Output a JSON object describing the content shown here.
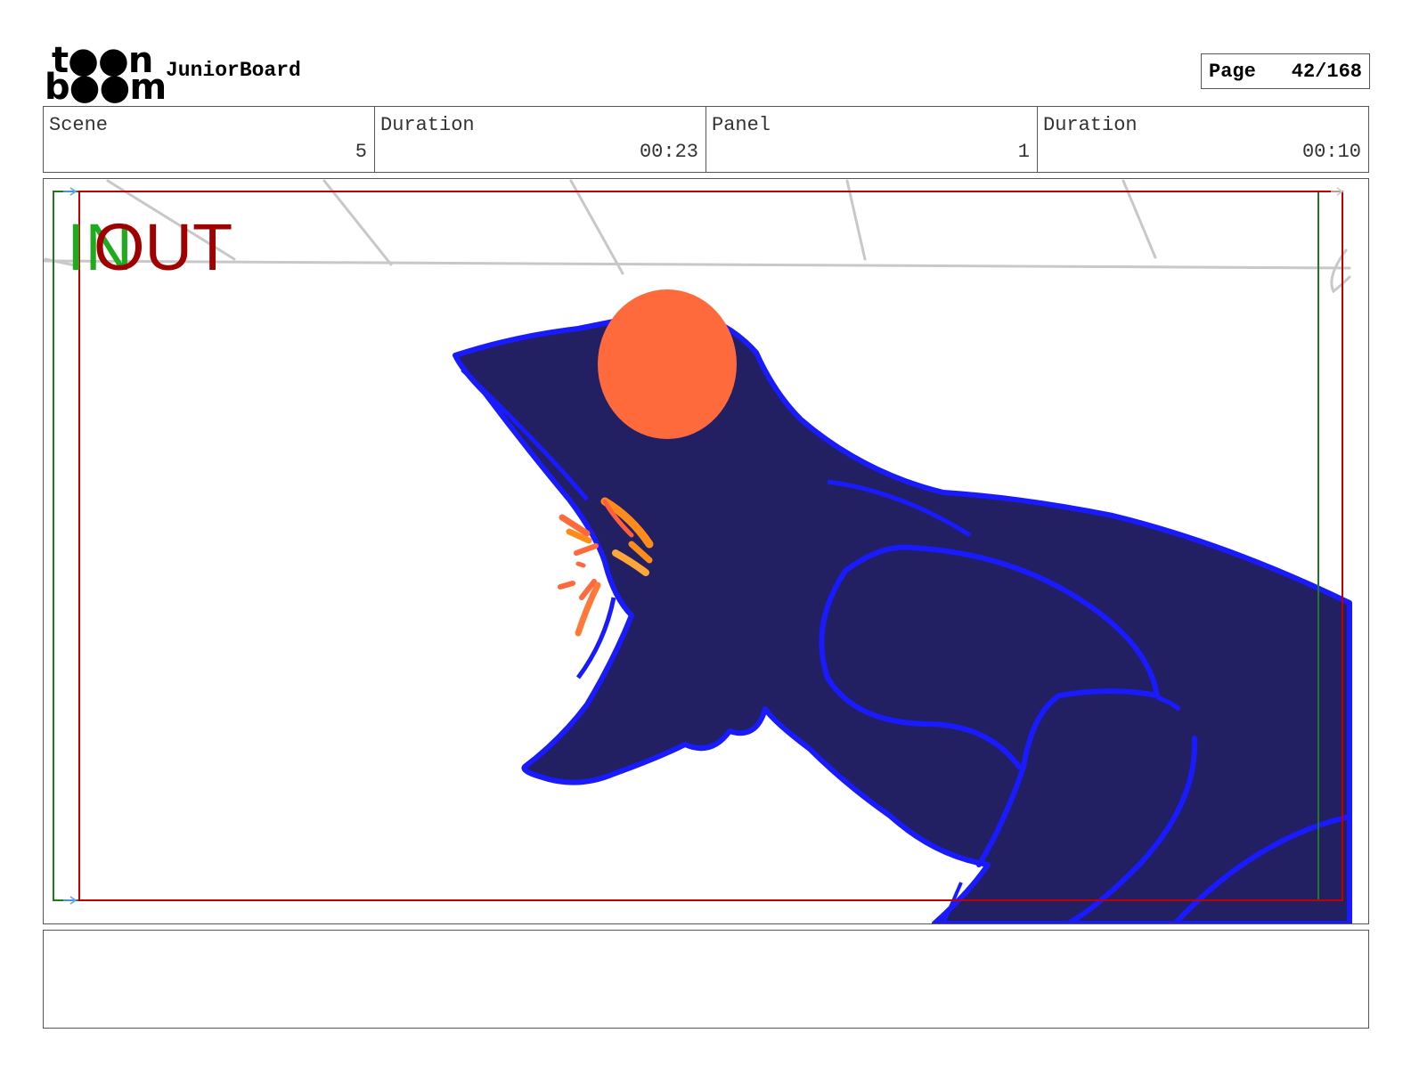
{
  "header": {
    "logo_line1": "t●●n",
    "logo_line2": "b●●m",
    "app_title": "JuniorBoard",
    "page_label": "Page",
    "page_value": "42/168"
  },
  "info": {
    "scene_label": "Scene",
    "scene_value": "5",
    "scene_duration_label": "Duration",
    "scene_duration_value": "00:23",
    "panel_label": "Panel",
    "panel_value": "1",
    "panel_duration_label": "Duration",
    "panel_duration_value": "00:10"
  },
  "panel": {
    "in_marker": "IN",
    "out_marker": "OUT",
    "colors": {
      "in_green": "#1faa1f",
      "out_red": "#a00000",
      "body_fill": "#231f63",
      "outline_blue": "#1a1aff",
      "eye_orange": "#ff6a3d",
      "sketch_gray": "#c8c8c8"
    }
  },
  "notes": {
    "text": ""
  }
}
